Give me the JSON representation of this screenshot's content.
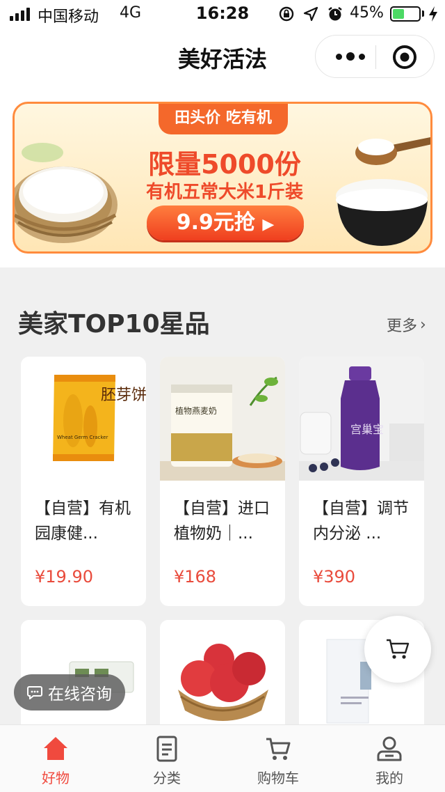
{
  "status_bar": {
    "carrier": "中国移动",
    "network": "4G",
    "time": "16:28",
    "battery_percent": "45%",
    "battery_level": 0.45,
    "icons": [
      "signal-icon",
      "lock-rotation-icon",
      "location-arrow-icon",
      "alarm-icon",
      "battery-icon",
      "charging-icon"
    ]
  },
  "nav": {
    "title": "美好活法",
    "icons": [
      "more-dots-icon",
      "close-circle-icon"
    ]
  },
  "banner": {
    "tag": "田头价 吃有机",
    "headline": "限量5000份",
    "subline": "有机五常大米1斤装",
    "cta": "9.9元抢"
  },
  "section": {
    "title": "美家TOP10星品",
    "more": "更多"
  },
  "products": [
    {
      "name": "【自营】有机园康健...",
      "price": "¥19.90"
    },
    {
      "name": "【自营】进口植物奶｜...",
      "price": "¥168"
    },
    {
      "name": "【自营】调节内分泌 ...",
      "price": "¥390"
    }
  ],
  "product_images_text": {
    "p1": "胚芽饼",
    "p1_en": "Wheat Germ Cracker",
    "p2": "植物燕麦奶",
    "p3": "宫巢宝"
  },
  "float": {
    "consult": "在线咨询"
  },
  "tabs": [
    {
      "label": "好物",
      "icon": "home-icon",
      "active": true
    },
    {
      "label": "分类",
      "icon": "list-icon",
      "active": false
    },
    {
      "label": "购物车",
      "icon": "cart-icon",
      "active": false
    },
    {
      "label": "我的",
      "icon": "user-icon",
      "active": false
    }
  ],
  "colors": {
    "accent": "#f04a3e",
    "price": "#e94b3c",
    "banner_orange": "#ff8b3d"
  }
}
